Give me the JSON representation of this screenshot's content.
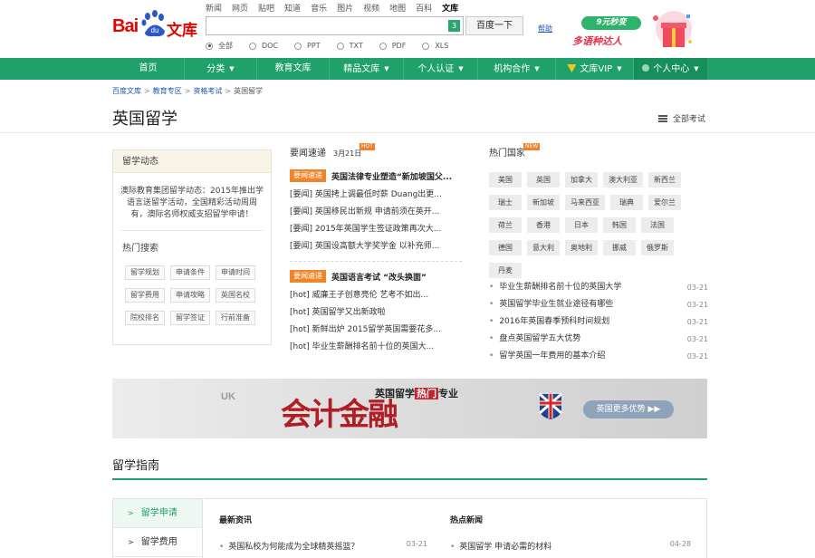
{
  "header": {
    "logo_bai": "Bai",
    "logo_du": "du",
    "logo_wenku": "文库",
    "topnav": [
      "新闻",
      "网页",
      "贴吧",
      "知道",
      "音乐",
      "图片",
      "视频",
      "地图",
      "百科",
      "文库"
    ],
    "topnav_active": "文库",
    "search_badge": "3",
    "search_button": "百度一下",
    "help": "帮助",
    "filetypes": [
      {
        "label": "全部",
        "selected": true
      },
      {
        "label": "DOC",
        "selected": false
      },
      {
        "label": "PPT",
        "selected": false
      },
      {
        "label": "TXT",
        "selected": false
      },
      {
        "label": "PDF",
        "selected": false
      },
      {
        "label": "XLS",
        "selected": false
      }
    ],
    "promo_pill": "9元秒变",
    "promo_slogan": "多语种达人"
  },
  "mainnav": [
    {
      "label": "首页",
      "caret": false
    },
    {
      "label": "分类",
      "caret": true
    },
    {
      "label": "教育文库",
      "caret": false
    },
    {
      "label": "精品文库",
      "caret": true
    },
    {
      "label": "个人认证",
      "caret": true
    },
    {
      "label": "机构合作",
      "caret": true
    },
    {
      "label": "文库VIP",
      "caret": true
    },
    {
      "label": "个人中心",
      "caret": true
    }
  ],
  "breadcrumb": {
    "links": [
      "百度文库",
      "教育专区",
      "资格考试"
    ],
    "current": "英国留学"
  },
  "page": {
    "title": "英国留学",
    "all_exams": "全部考试"
  },
  "left_panel": {
    "heading": "留学动态",
    "description": "澳际教育集团留学动态：2015年推出学语言送留学活动，全国精彩活动周周有，澳际名师权威支招留学申请！",
    "hot_search_heading": "热门搜索",
    "tags": [
      "留学规划",
      "申请条件",
      "申请时间",
      "留学费用",
      "申请攻略",
      "英国名校",
      "院校排名",
      "留学签证",
      "行前准备"
    ]
  },
  "news": {
    "heading": "要闻速递",
    "date": "3月21日",
    "hot_badge": "HOT",
    "lead1": {
      "tag": "要闻速递",
      "text": "英国法律专业塑造“新加坡国父..."
    },
    "list1": [
      "[要闻] 英国拷上调最低时薪 Duang出更...",
      "[要闻] 英国移民出新规 申请前须在英开...",
      "[要闻] 2015年英国学生签证政策再次大...",
      "[要闻] 英国设高额大学奖学金 以补充师..."
    ],
    "lead2": {
      "tag": "要闻速递",
      "text": "英国语言考试 “改头换面”"
    },
    "list2": [
      "[hot] 威廉王子创意亮伦 艺考不如出...",
      "[hot] 英国留学又出新政啦",
      "[hot] 新鲜出炉 2015留学英国需要花多...",
      "[hot] 毕业生薪酬排名前十位的英国大..."
    ]
  },
  "hot_countries": {
    "heading": "热门国家",
    "new_badge": "NEW",
    "countries": [
      "美国",
      "英国",
      "加拿大",
      "澳大利亚",
      "新西兰",
      "瑞士",
      "新加坡",
      "马来西亚",
      "瑞典",
      "爱尔兰",
      "荷兰",
      "香港",
      "日本",
      "韩国",
      "法国",
      "德国",
      "意大利",
      "奥地利",
      "挪威",
      "俄罗斯",
      "丹麦"
    ],
    "list": [
      {
        "title": "毕业生薪酬排名前十位的英国大学",
        "date": "03-21"
      },
      {
        "title": "英国留学毕业生就业途径有哪些",
        "date": "03-21"
      },
      {
        "title": "2016年英国春季预科时间规划",
        "date": "03-21"
      },
      {
        "title": "盘点英国留学五大优势",
        "date": "03-21"
      },
      {
        "title": "留学英国一年费用的基本介绍",
        "date": "03-21"
      }
    ]
  },
  "banner": {
    "uk": "UK",
    "big": "会计金融",
    "sub_pre": "英国留学",
    "sub_hot": "热门",
    "sub_post": "专业",
    "cta": "英国更多优势 ▶▶"
  },
  "guide": {
    "title": "留学指南",
    "side": [
      {
        "label": "留学申请",
        "active": true
      },
      {
        "label": "留学费用",
        "active": false
      }
    ],
    "latest_heading": "最新资讯",
    "latest": [
      {
        "title": "英国私校为何能成为全球精英摇篮？",
        "date": "03-21"
      }
    ],
    "hot_heading": "热点新闻",
    "hot": [
      {
        "title": "英国留学 申请必需的材料",
        "date": "04-28"
      }
    ]
  },
  "colors": {
    "brand_green": "#20a06b",
    "baidu_red": "#e10600",
    "accent_orange": "#f08528",
    "link_blue": "#1a55b8"
  }
}
